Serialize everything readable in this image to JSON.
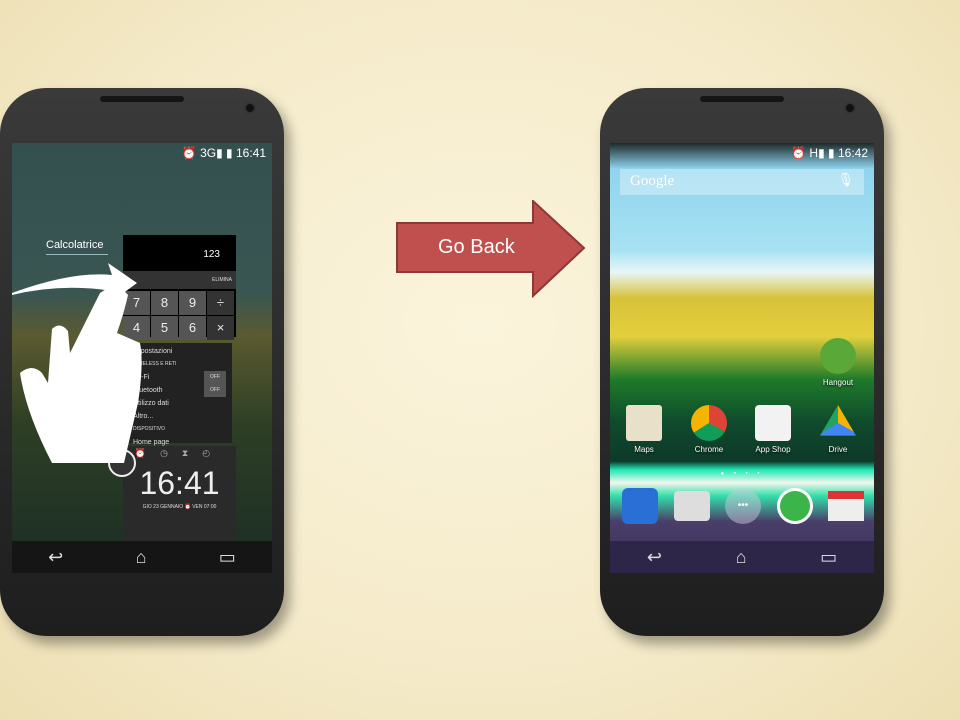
{
  "left_phone": {
    "time": "16:41",
    "network": "3G",
    "recents": {
      "calc_label": "Calcolatrice",
      "calc_display": "123",
      "calc_delete": "ELIMINA",
      "calc_keys": [
        "7",
        "8",
        "9",
        "÷",
        "4",
        "5",
        "6",
        "×"
      ],
      "settings_title": "Impostazioni",
      "settings_section1": "WIRELESS E RETI",
      "settings_items": [
        "Wi-Fi",
        "Bluetooth",
        "Utilizzo dati",
        "Altro..."
      ],
      "toggle_off": "OFF",
      "settings_section2": "DISPOSITIVO",
      "settings_home": "Home page",
      "clock_time": "16:41",
      "clock_date": "GIO 23 GENNAIO",
      "clock_alarm": "VEN 07:00"
    }
  },
  "arrow": {
    "label": "Go Back",
    "color": "#c0504d"
  },
  "right_phone": {
    "time": "16:42",
    "network": "H",
    "search_placeholder": "Google",
    "apps": [
      {
        "label": "Hangout",
        "color": "#5aa837"
      },
      {
        "label": "Maps",
        "color": "#e8e0c8"
      },
      {
        "label": "Chrome",
        "color": "#db4437"
      },
      {
        "label": "App Shop",
        "color": "#f2f2f2"
      },
      {
        "label": "Drive",
        "color": "#1fa463"
      }
    ],
    "dock": [
      {
        "name": "phone",
        "color": "#2a6fd6"
      },
      {
        "name": "camera",
        "color": "#dddddd"
      },
      {
        "name": "app-drawer",
        "color": "#8a8aa0"
      },
      {
        "name": "whatsapp",
        "color": "#3bb54a"
      },
      {
        "name": "gmail",
        "color": "#eeeeee"
      }
    ]
  }
}
